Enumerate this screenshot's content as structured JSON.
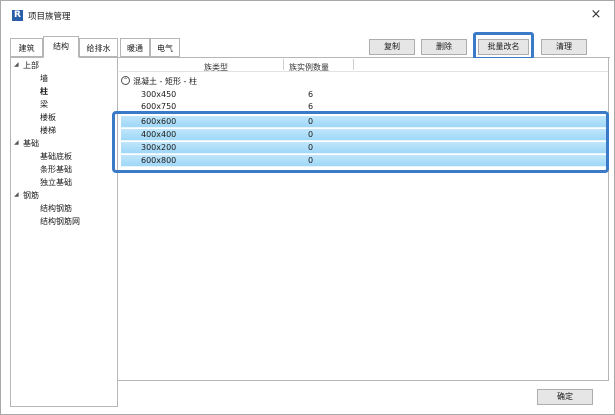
{
  "window": {
    "title": "项目族管理",
    "app_icon_letter": "R",
    "close_glyph": "×"
  },
  "tabs": [
    {
      "label": "建筑",
      "active": false
    },
    {
      "label": "结构",
      "active": true
    },
    {
      "label": "给排水",
      "active": false
    },
    {
      "label": "暖通",
      "active": false
    },
    {
      "label": "电气",
      "active": false
    }
  ],
  "toolbar": {
    "copy_label": "复制",
    "delete_label": "删除",
    "batch_rename_label": "批量改名",
    "clean_label": "清理"
  },
  "tree": {
    "items": [
      {
        "label": "上部",
        "expanded": true
      },
      {
        "label": "墙"
      },
      {
        "label": "柱",
        "selected": true
      },
      {
        "label": "梁"
      },
      {
        "label": "楼板"
      },
      {
        "label": "楼梯"
      },
      {
        "label": "基础",
        "expanded": true
      },
      {
        "label": "基础底板"
      },
      {
        "label": "条形基础"
      },
      {
        "label": "独立基础"
      },
      {
        "label": "钢筋",
        "expanded": true
      },
      {
        "label": "结构钢筋"
      },
      {
        "label": "结构钢筋网"
      }
    ],
    "expand_glyph": "◢"
  },
  "grid": {
    "columns": [
      "族类型",
      "族实例数量"
    ],
    "group": {
      "label": "混凝土 - 矩形 - 柱",
      "collapse_glyph": "⌃"
    },
    "rows": [
      {
        "type": "300x450",
        "count": "6",
        "selected": false
      },
      {
        "type": "600x750",
        "count": "6",
        "selected": false
      },
      {
        "type": "600x600",
        "count": "0",
        "selected": true
      },
      {
        "type": "400x400",
        "count": "0",
        "selected": true
      },
      {
        "type": "300x200",
        "count": "0",
        "selected": true
      },
      {
        "type": "600x800",
        "count": "0",
        "selected": true
      }
    ]
  },
  "footer": {
    "ok_label": "确定"
  },
  "colors": {
    "highlight_frame": "#3b7ac7",
    "selected_row": "#9fd7f7",
    "app_icon": "#2a5ea8"
  }
}
